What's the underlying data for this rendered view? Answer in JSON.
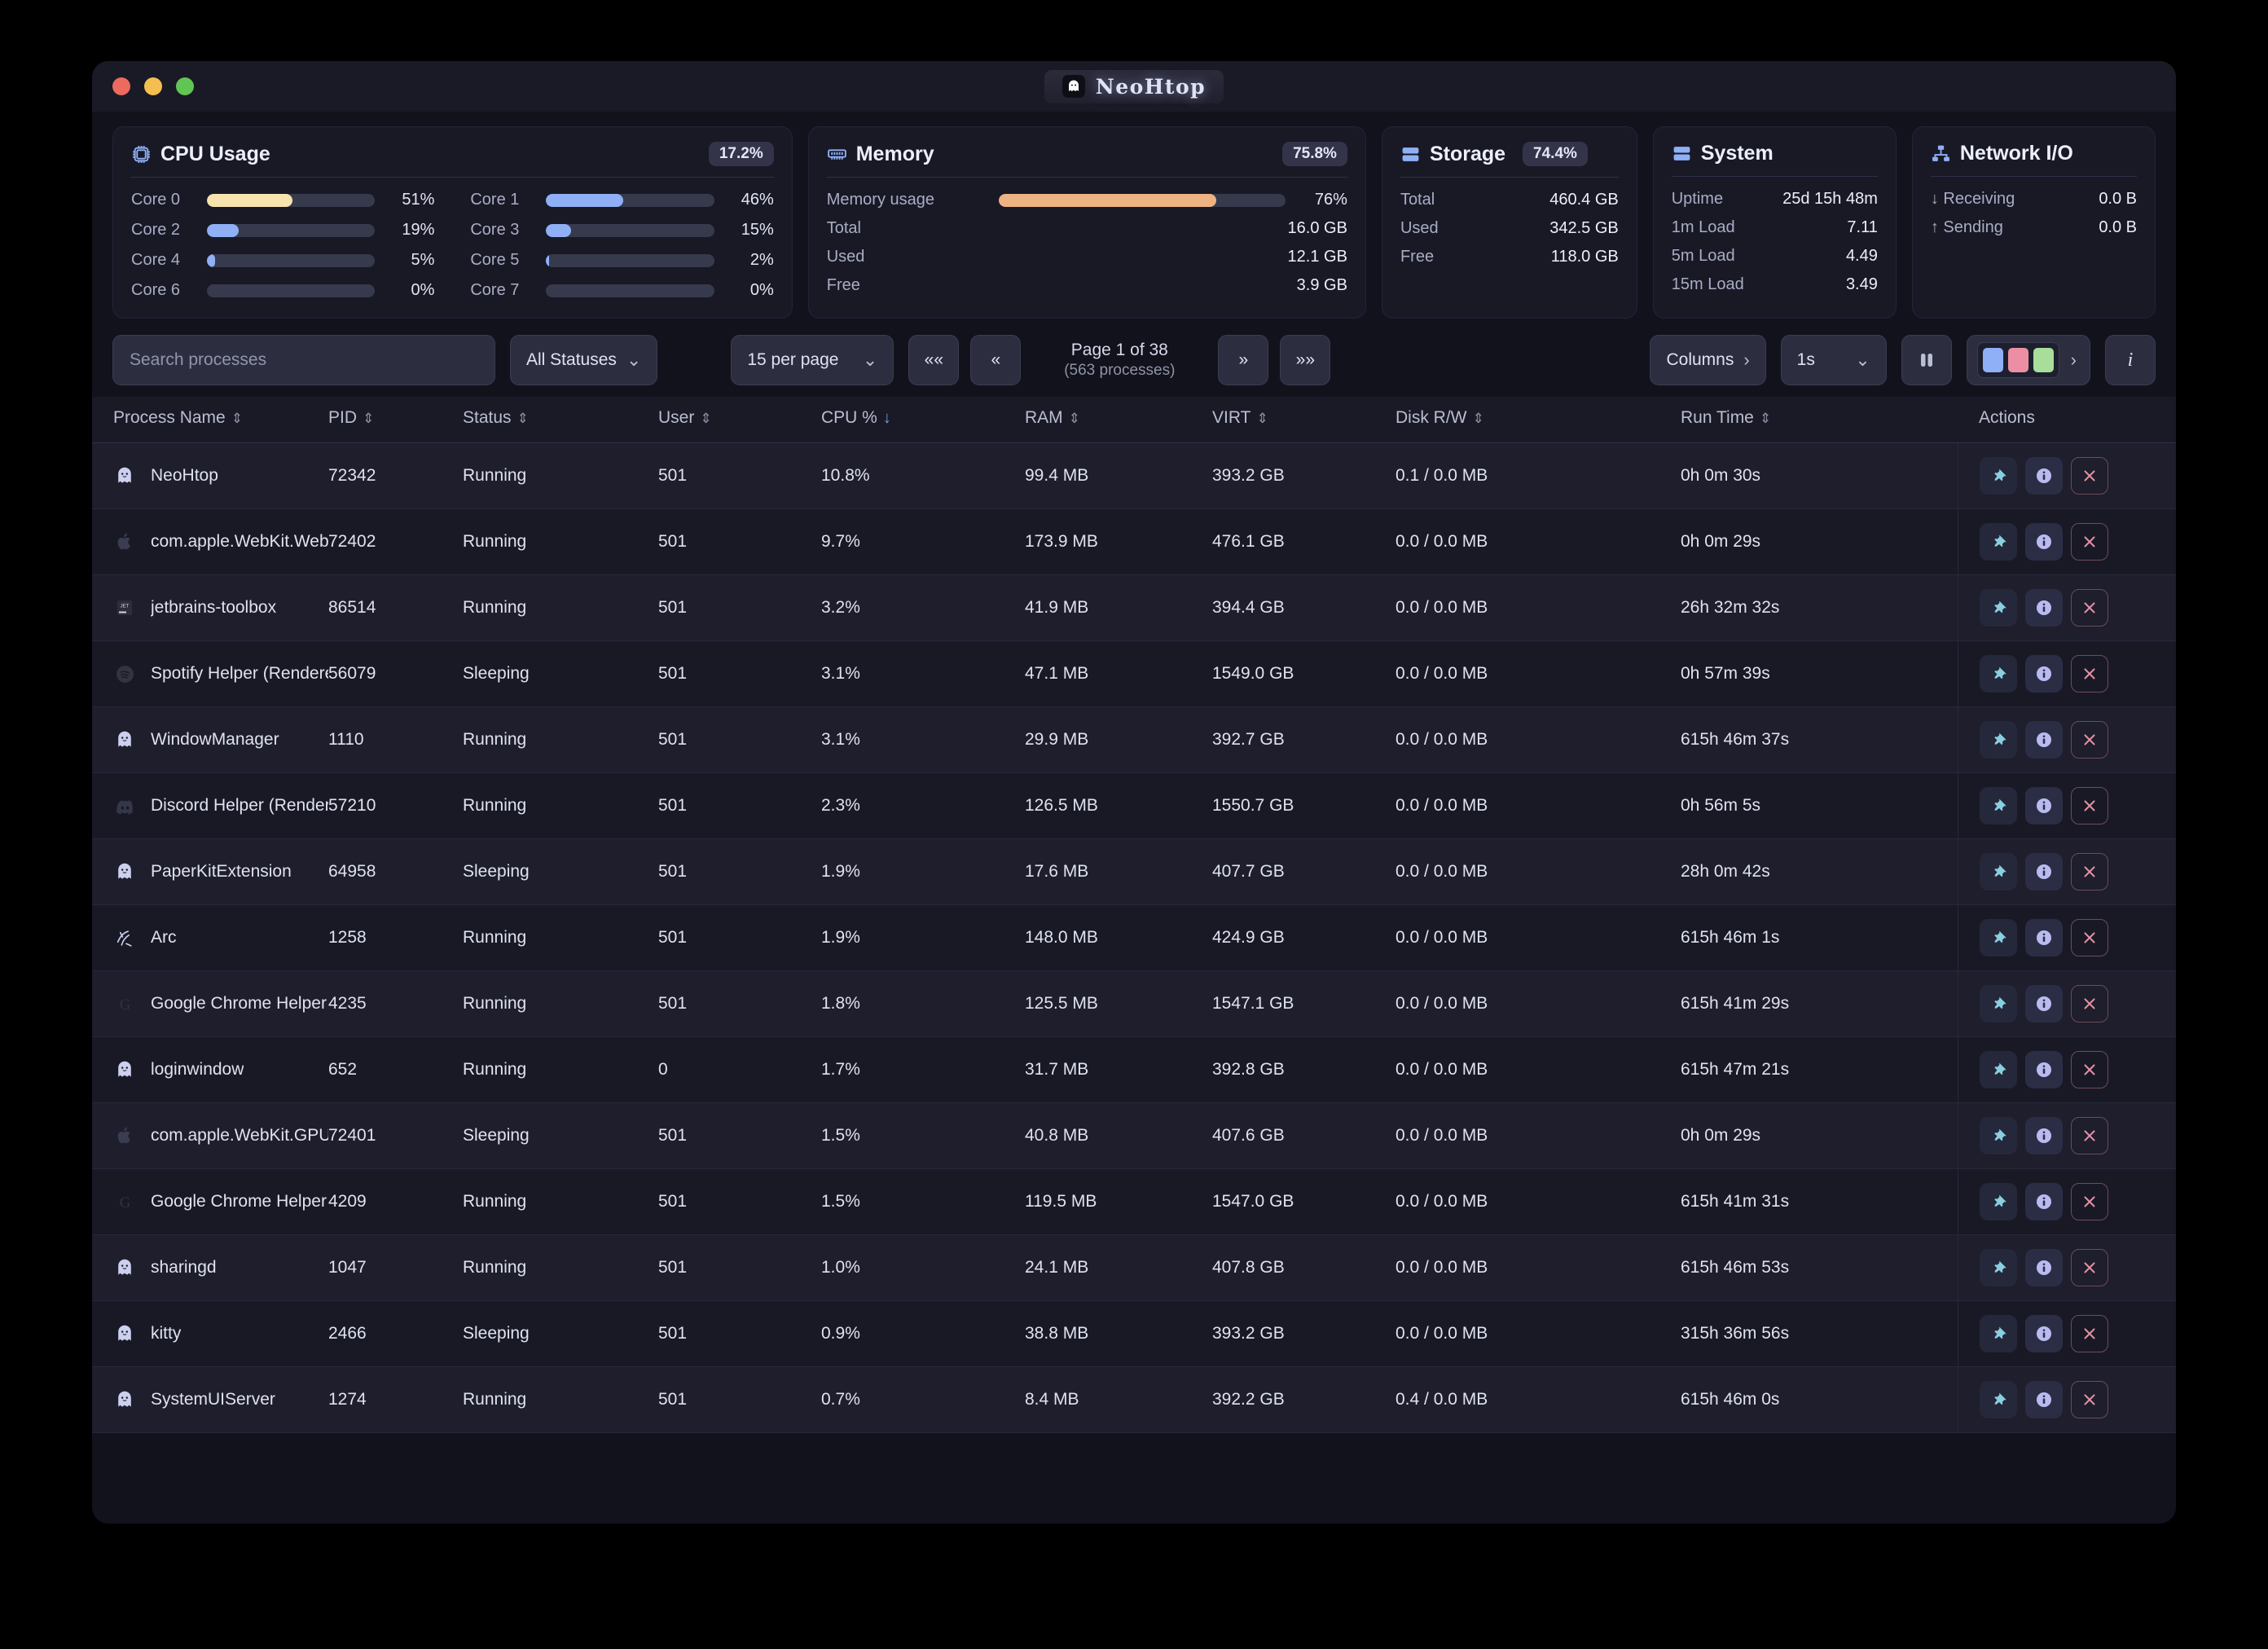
{
  "window": {
    "title": "NeoHtop",
    "traffic_lights": [
      "close-red",
      "minimize-yellow",
      "maximize-green"
    ]
  },
  "cards": {
    "cpu": {
      "title": "CPU Usage",
      "badge": "17.2%",
      "icon": "cpu-chip-icon",
      "cores": [
        {
          "label": "Core 0",
          "pct": 51,
          "value": "51%",
          "color": "#f7e3ae"
        },
        {
          "label": "Core 1",
          "pct": 46,
          "value": "46%",
          "color": "#8fb0f6"
        },
        {
          "label": "Core 2",
          "pct": 19,
          "value": "19%",
          "color": "#8fb0f6"
        },
        {
          "label": "Core 3",
          "pct": 15,
          "value": "15%",
          "color": "#8fb0f6"
        },
        {
          "label": "Core 4",
          "pct": 5,
          "value": "5%",
          "color": "#8fb0f6"
        },
        {
          "label": "Core 5",
          "pct": 2,
          "value": "2%",
          "color": "#8fb0f6"
        },
        {
          "label": "Core 6",
          "pct": 0,
          "value": "0%",
          "color": "#8fb0f6"
        },
        {
          "label": "Core 7",
          "pct": 0,
          "value": "0%",
          "color": "#8fb0f6"
        }
      ]
    },
    "memory": {
      "title": "Memory",
      "badge": "75.8%",
      "icon": "memory-stick-icon",
      "usage_label": "Memory usage",
      "usage_pct": 76,
      "usage_value": "76%",
      "usage_color": "#efb283",
      "rows": [
        {
          "label": "Total",
          "value": "16.0 GB"
        },
        {
          "label": "Used",
          "value": "12.1 GB"
        },
        {
          "label": "Free",
          "value": "3.9 GB"
        }
      ]
    },
    "storage": {
      "title": "Storage",
      "badge": "74.4%",
      "icon": "hard-drive-icon",
      "rows": [
        {
          "label": "Total",
          "value": "460.4 GB"
        },
        {
          "label": "Used",
          "value": "342.5 GB"
        },
        {
          "label": "Free",
          "value": "118.0 GB"
        }
      ]
    },
    "system": {
      "title": "System",
      "icon": "server-icon",
      "rows": [
        {
          "label": "Uptime",
          "value": "25d 15h 48m"
        },
        {
          "label": "1m Load",
          "value": "7.11"
        },
        {
          "label": "5m Load",
          "value": "4.49"
        },
        {
          "label": "15m Load",
          "value": "3.49"
        }
      ]
    },
    "network": {
      "title": "Network I/O",
      "icon": "network-icon",
      "rows": [
        {
          "label": "↓ Receiving",
          "value": "0.0 B"
        },
        {
          "label": "↑ Sending",
          "value": "0.0 B"
        }
      ]
    }
  },
  "toolbar": {
    "search_placeholder": "Search processes",
    "search_value": "",
    "status_filter": "All Statuses",
    "per_page": "15 per page",
    "first_page_label": "««",
    "prev_page_label": "«",
    "page_text": "Page 1 of 38",
    "process_count_text": "(563 processes)",
    "next_page_label": "»",
    "last_page_label": "»»",
    "columns_label": "Columns",
    "refresh_interval": "1s",
    "pause_label": "pause-icon",
    "theme_swatches": [
      "#8fb0f6",
      "#ec8fa4",
      "#a9dd9a"
    ],
    "info_label": "i"
  },
  "table": {
    "columns": [
      {
        "label": "Process Name",
        "sort": "both"
      },
      {
        "label": "PID",
        "sort": "both"
      },
      {
        "label": "Status",
        "sort": "both"
      },
      {
        "label": "User",
        "sort": "both"
      },
      {
        "label": "CPU %",
        "sort": "desc"
      },
      {
        "label": "RAM",
        "sort": "both"
      },
      {
        "label": "VIRT",
        "sort": "both"
      },
      {
        "label": "Disk R/W",
        "sort": "both"
      },
      {
        "label": "Run Time",
        "sort": "both"
      },
      {
        "label": "Actions",
        "sort": "none"
      }
    ],
    "rows": [
      {
        "icon": "ghost-icon",
        "name": "NeoHtop",
        "pid": "72342",
        "status": "Running",
        "user": "501",
        "cpu": "10.8%",
        "ram": "99.4 MB",
        "virt": "393.2 GB",
        "disk": "0.1 / 0.0 MB",
        "runtime": "0h 0m 30s"
      },
      {
        "icon": "apple-icon",
        "name": "com.apple.WebKit.WebCo",
        "pid": "72402",
        "status": "Running",
        "user": "501",
        "cpu": "9.7%",
        "ram": "173.9 MB",
        "virt": "476.1 GB",
        "disk": "0.0 / 0.0 MB",
        "runtime": "0h 0m 29s"
      },
      {
        "icon": "jetbrains-icon",
        "name": "jetbrains-toolbox",
        "pid": "86514",
        "status": "Running",
        "user": "501",
        "cpu": "3.2%",
        "ram": "41.9 MB",
        "virt": "394.4 GB",
        "disk": "0.0 / 0.0 MB",
        "runtime": "26h 32m 32s"
      },
      {
        "icon": "spotify-icon",
        "name": "Spotify Helper (Renderer)",
        "pid": "56079",
        "status": "Sleeping",
        "user": "501",
        "cpu": "3.1%",
        "ram": "47.1 MB",
        "virt": "1549.0 GB",
        "disk": "0.0 / 0.0 MB",
        "runtime": "0h 57m 39s"
      },
      {
        "icon": "ghost-icon",
        "name": "WindowManager",
        "pid": "1110",
        "status": "Running",
        "user": "501",
        "cpu": "3.1%",
        "ram": "29.9 MB",
        "virt": "392.7 GB",
        "disk": "0.0 / 0.0 MB",
        "runtime": "615h 46m 37s"
      },
      {
        "icon": "discord-icon",
        "name": "Discord Helper (Renderer)",
        "pid": "57210",
        "status": "Running",
        "user": "501",
        "cpu": "2.3%",
        "ram": "126.5 MB",
        "virt": "1550.7 GB",
        "disk": "0.0 / 0.0 MB",
        "runtime": "0h 56m 5s"
      },
      {
        "icon": "ghost-icon",
        "name": "PaperKitExtension",
        "pid": "64958",
        "status": "Sleeping",
        "user": "501",
        "cpu": "1.9%",
        "ram": "17.6 MB",
        "virt": "407.7 GB",
        "disk": "0.0 / 0.0 MB",
        "runtime": "28h 0m 42s"
      },
      {
        "icon": "arc-icon",
        "name": "Arc",
        "pid": "1258",
        "status": "Running",
        "user": "501",
        "cpu": "1.9%",
        "ram": "148.0 MB",
        "virt": "424.9 GB",
        "disk": "0.0 / 0.0 MB",
        "runtime": "615h 46m 1s"
      },
      {
        "icon": "chrome-icon",
        "name": "Google Chrome Helper (Re",
        "pid": "4235",
        "status": "Running",
        "user": "501",
        "cpu": "1.8%",
        "ram": "125.5 MB",
        "virt": "1547.1 GB",
        "disk": "0.0 / 0.0 MB",
        "runtime": "615h 41m 29s"
      },
      {
        "icon": "ghost-icon",
        "name": "loginwindow",
        "pid": "652",
        "status": "Running",
        "user": "0",
        "cpu": "1.7%",
        "ram": "31.7 MB",
        "virt": "392.8 GB",
        "disk": "0.0 / 0.0 MB",
        "runtime": "615h 47m 21s"
      },
      {
        "icon": "apple-icon",
        "name": "com.apple.WebKit.GPU",
        "pid": "72401",
        "status": "Sleeping",
        "user": "501",
        "cpu": "1.5%",
        "ram": "40.8 MB",
        "virt": "407.6 GB",
        "disk": "0.0 / 0.0 MB",
        "runtime": "0h 0m 29s"
      },
      {
        "icon": "chrome-icon",
        "name": "Google Chrome Helper (Re",
        "pid": "4209",
        "status": "Running",
        "user": "501",
        "cpu": "1.5%",
        "ram": "119.5 MB",
        "virt": "1547.0 GB",
        "disk": "0.0 / 0.0 MB",
        "runtime": "615h 41m 31s"
      },
      {
        "icon": "ghost-icon",
        "name": "sharingd",
        "pid": "1047",
        "status": "Running",
        "user": "501",
        "cpu": "1.0%",
        "ram": "24.1 MB",
        "virt": "407.8 GB",
        "disk": "0.0 / 0.0 MB",
        "runtime": "615h 46m 53s"
      },
      {
        "icon": "ghost-icon",
        "name": "kitty",
        "pid": "2466",
        "status": "Sleeping",
        "user": "501",
        "cpu": "0.9%",
        "ram": "38.8 MB",
        "virt": "393.2 GB",
        "disk": "0.0 / 0.0 MB",
        "runtime": "315h 36m 56s"
      },
      {
        "icon": "ghost-icon",
        "name": "SystemUIServer",
        "pid": "1274",
        "status": "Running",
        "user": "501",
        "cpu": "0.7%",
        "ram": "8.4 MB",
        "virt": "392.2 GB",
        "disk": "0.4 / 0.0 MB",
        "runtime": "615h 46m 0s"
      }
    ],
    "row_actions": {
      "pin": "pin-icon",
      "info": "info-icon",
      "kill": "close-x-icon"
    }
  }
}
